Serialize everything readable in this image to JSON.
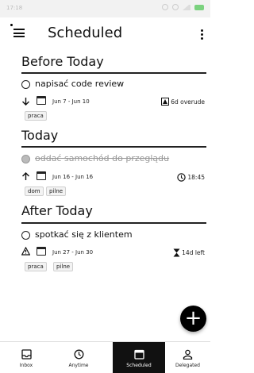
{
  "status_bar": {
    "time": "17:18"
  },
  "header": {
    "title": "Scheduled"
  },
  "sections": {
    "before_today": {
      "title": "Before Today",
      "task": {
        "title": "napisać code review",
        "date_range": "Jun 7 - Jun 10",
        "meta": "6d overude",
        "tags": [
          "praca"
        ]
      }
    },
    "today": {
      "title": "Today",
      "task": {
        "title": "oddać samochód do przeglądu",
        "date_range": "Jun 16 - Jun 16",
        "meta": "18:45",
        "tags": [
          "dom",
          "pilne"
        ]
      }
    },
    "after_today": {
      "title": "After Today",
      "task": {
        "title": "spotkać się z klientem",
        "date_range": "Jun 27 - Jun 30",
        "meta": "14d left",
        "tags": [
          "praca",
          "pilne"
        ]
      }
    }
  },
  "fab": {
    "label": "+"
  },
  "nav": {
    "items": [
      {
        "label": "Inbox",
        "icon": "inbox-icon"
      },
      {
        "label": "Anytime",
        "icon": "clock-icon"
      },
      {
        "label": "Scheduled",
        "icon": "calendar-icon",
        "active": true
      },
      {
        "label": "Delegated",
        "icon": "person-icon"
      }
    ]
  },
  "colors": {
    "accent": "#111111",
    "background": "#ffffff",
    "tag_background": "#f3f3f3"
  }
}
